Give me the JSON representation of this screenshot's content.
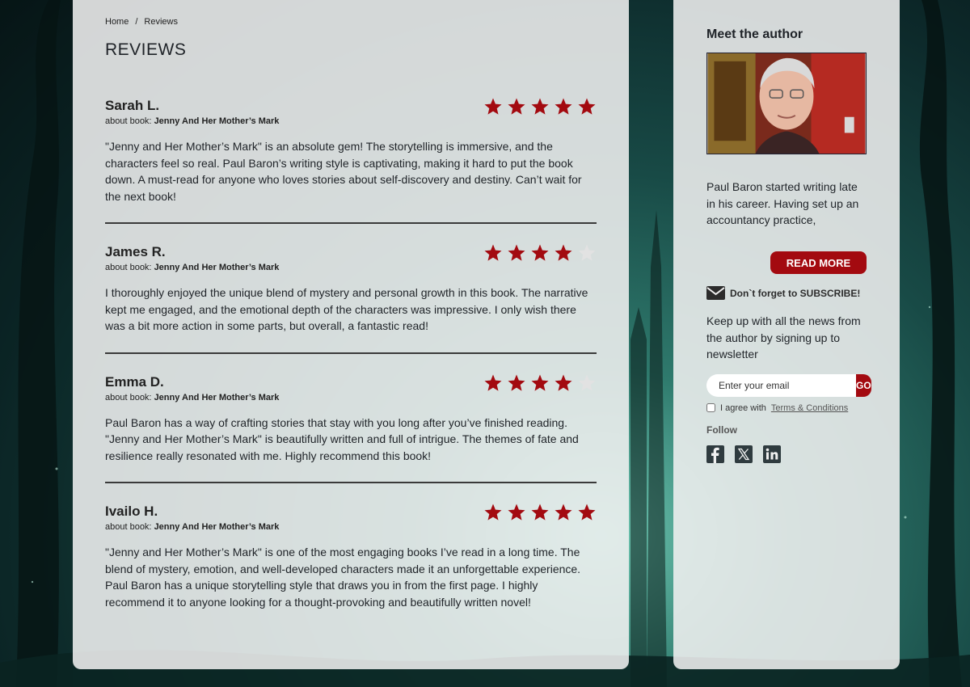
{
  "colors": {
    "accent": "#a30a10",
    "star_filled": "#a30a10",
    "star_empty": "#e2e2e2",
    "panel_bg": "#f0f0f0"
  },
  "breadcrumb": {
    "home": "Home",
    "separator": "/",
    "current": "Reviews"
  },
  "page_title": "REVIEWS",
  "about_prefix": "about book:",
  "reviews": [
    {
      "name": "Sarah L.",
      "book": "Jenny And Her Mother’s Mark",
      "rating": 5,
      "text": "\"Jenny and Her Mother’s Mark\" is an absolute gem! The storytelling is immersive, and the characters feel so real. Paul Baron’s writing style is captivating, making it hard to put the book down. A must-read for anyone who loves stories about self-discovery and destiny. Can’t wait for the next book!"
    },
    {
      "name": "James R.",
      "book": "Jenny And Her Mother’s Mark",
      "rating": 4,
      "text": "I thoroughly enjoyed the unique blend of mystery and personal growth in this book. The narrative kept me engaged, and the emotional depth of the characters was impressive. I only wish there was a bit more action in some parts, but overall, a fantastic read!"
    },
    {
      "name": "Emma D.",
      "book": "Jenny And Her Mother’s Mark",
      "rating": 4,
      "text": "Paul Baron has a way of crafting stories that stay with you long after you’ve finished reading. \"Jenny and Her Mother’s Mark\" is beautifully written and full of intrigue. The themes of fate and resilience really resonated with me. Highly recommend this book!"
    },
    {
      "name": "Ivailo H.",
      "book": "Jenny And Her Mother’s Mark",
      "rating": 5,
      "text": "\"Jenny and Her Mother’s Mark\" is one of the most engaging books I’ve read in a long time. The blend of mystery, emotion, and well-developed characters made it an unforgettable experience. Paul Baron has a unique storytelling style that draws you in from the first page. I highly recommend it to anyone looking for a thought-provoking and beautifully written novel!"
    }
  ],
  "sidebar": {
    "title": "Meet the author",
    "bio": "Paul Baron started writing late in his career. Having set up an accountancy practice,",
    "read_more": "READ MORE",
    "subscribe_note": "Don`t forget to SUBSCRIBE!",
    "newsletter_text": "Keep up with all the news from the author by signing up to newsletter",
    "email_placeholder": "Enter your email",
    "go_label": "GO",
    "agree_prefix": "I agree with",
    "terms_link": "Terms & Conditions",
    "follow_label": "Follow",
    "social": [
      "facebook-icon",
      "x-icon",
      "linkedin-icon"
    ]
  }
}
